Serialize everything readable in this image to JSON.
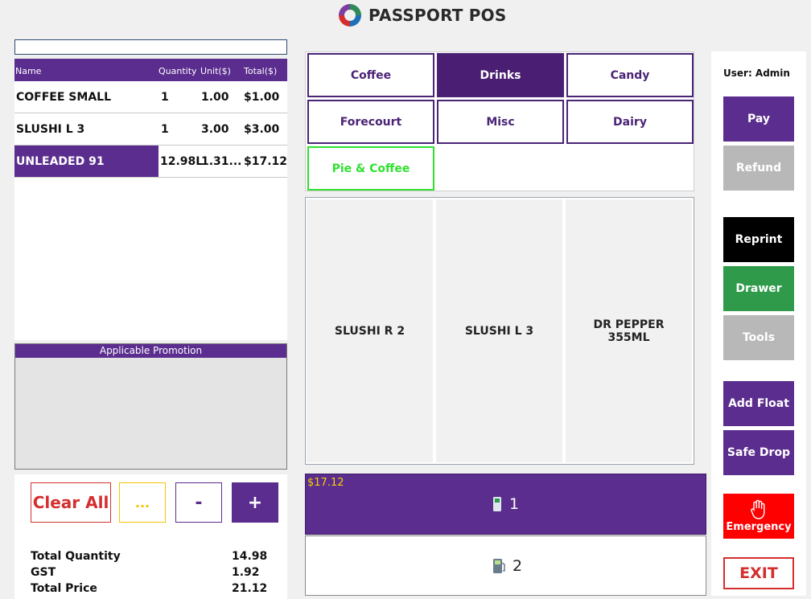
{
  "header": {
    "title": "PASSPORT POS"
  },
  "items_table": {
    "columns": [
      "Name",
      "Quantity",
      "Unit($)",
      "Total($)"
    ],
    "rows": [
      {
        "name": "COFFEE SMALL",
        "qty": "1",
        "unit": "1.00",
        "total": "$1.00"
      },
      {
        "name": "SLUSHI L 3",
        "qty": "1",
        "unit": "3.00",
        "total": "$3.00"
      },
      {
        "name": "UNLEADED 91",
        "qty": "12.98L",
        "unit": "1.31...",
        "total": "$17.12",
        "selected": true
      }
    ]
  },
  "promotion": {
    "title": "Applicable Promotion"
  },
  "actions": {
    "clear_all": "Clear All",
    "more": "...",
    "minus": "-",
    "plus": "+"
  },
  "totals": [
    {
      "label": "Total Quantity",
      "value": "14.98"
    },
    {
      "label": "GST",
      "value": "1.92"
    },
    {
      "label": "Total Price",
      "value": "21.12"
    }
  ],
  "categories": [
    {
      "label": "Coffee"
    },
    {
      "label": "Drinks",
      "active": true
    },
    {
      "label": "Candy"
    },
    {
      "label": "Forecourt"
    },
    {
      "label": "Misc"
    },
    {
      "label": "Dairy"
    },
    {
      "label": "Pie & Coffee"
    }
  ],
  "products": [
    "SLUSHI R 2",
    "SLUSHI L 3",
    "DR PEPPER\n355ML"
  ],
  "pumps": [
    {
      "amount": "$17.12",
      "number": "1"
    },
    {
      "number": "2"
    }
  ],
  "user": {
    "label": "User: Admin"
  },
  "side_buttons": {
    "pay": "Pay",
    "refund": "Refund",
    "reprint": "Reprint",
    "drawer": "Drawer",
    "tools": "Tools",
    "add_float": "Add Float",
    "safe_drop": "Safe Drop",
    "emergency": "Emergency",
    "exit": "EXIT"
  },
  "colors": {
    "purple": "#5b2d8e",
    "dark_purple": "#4a1e72",
    "green_border": "#2fe02f",
    "drawer_green": "#2e9a4a",
    "disabled_gray": "#b8b8b8",
    "emergency_red": "#ff0000",
    "exit_red": "#d32f2f",
    "pump_amount_yellow": "#f5d000"
  }
}
